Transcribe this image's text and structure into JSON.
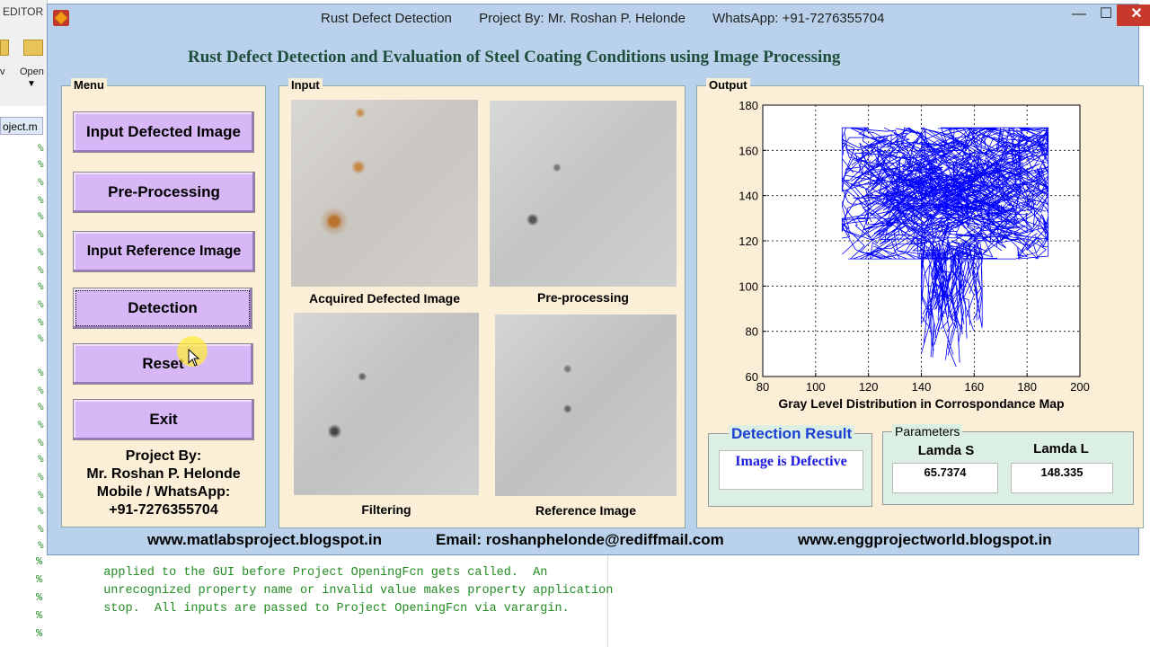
{
  "editor": {
    "tab_label": "EDITOR",
    "open_label": "Open",
    "v_label": "v",
    "file_tab": "oject.m",
    "gutter_symbol": "%",
    "code_lines": [
      "  unrecognized property name or invalid value makes property application",
      "  applied to the GUI before Project OpeningFcn gets called.  An",
      "  unrecognized property name or invalid value makes property application",
      "  stop.  All inputs are passed to Project OpeningFcn via varargin."
    ]
  },
  "window": {
    "title_app": "Rust Defect Detection",
    "title_author": "Project By: Mr. Roshan P. Helonde",
    "title_contact": "WhatsApp: +91-7276355704",
    "minimize_glyph": "—",
    "maximize_glyph": "☐",
    "close_glyph": "✕"
  },
  "heading": "Rust Defect Detection and Evaluation of Steel Coating Conditions using Image Processing",
  "menu": {
    "title": "Menu",
    "buttons": [
      "Input Defected Image",
      "Pre-Processing",
      "Input Reference Image",
      "Detection",
      "Reset",
      "Exit"
    ],
    "credit_lines": [
      "Project By:",
      "Mr. Roshan P. Helonde",
      "Mobile / WhatsApp:",
      "+91-7276355704"
    ]
  },
  "input_panel": {
    "title": "Input",
    "captions": [
      "Acquired Defected Image",
      "Pre-processing",
      "Filtering",
      "Reference Image"
    ]
  },
  "output_panel": {
    "title": "Output"
  },
  "chart_data": {
    "type": "line",
    "xlabel": "Gray Level Distribution in Corrospondance Map",
    "ylabel": "",
    "xlim": [
      80,
      200
    ],
    "ylim": [
      60,
      180
    ],
    "x_ticks": [
      80,
      100,
      120,
      140,
      160,
      180,
      200
    ],
    "y_ticks": [
      60,
      80,
      100,
      120,
      140,
      160,
      180
    ],
    "grid": true,
    "series": [
      {
        "color": "#0000ff",
        "cluster_center": [
          155,
          140
        ],
        "cluster_x_range": [
          110,
          188
        ],
        "cluster_y_range": [
          63,
          170
        ],
        "dense_region": [
          [
            120,
            188
          ],
          [
            120,
            165
          ]
        ],
        "tail_region": [
          [
            140,
            163
          ],
          [
            63,
            120
          ]
        ]
      }
    ]
  },
  "detection": {
    "title": "Detection Result",
    "value": "Image is Defective"
  },
  "parameters": {
    "title": "Parameters",
    "items": [
      {
        "label": "Lamda S",
        "value": "65.7374"
      },
      {
        "label": "Lamda L",
        "value": "148.335"
      }
    ]
  },
  "footer": {
    "blog1": "www.matlabsproject.blogspot.in",
    "email": "Email: roshanphelonde@rediffmail.com",
    "blog2": "www.enggprojectworld.blogspot.in"
  }
}
